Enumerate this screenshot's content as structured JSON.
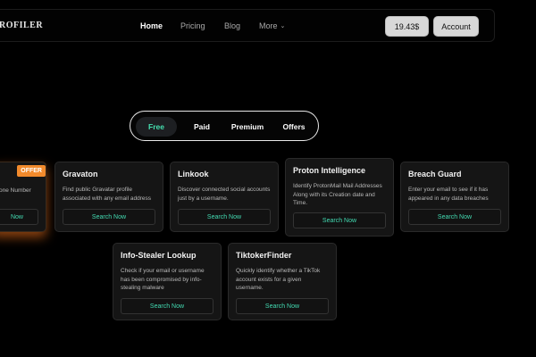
{
  "navbar": {
    "brand": "ROFILER",
    "links": [
      {
        "label": "Home",
        "active": true
      },
      {
        "label": "Pricing",
        "active": false
      },
      {
        "label": "Blog",
        "active": false
      },
      {
        "label": "More",
        "active": false
      }
    ],
    "balance": "19.43$",
    "account": "Account"
  },
  "tabs": [
    {
      "label": "Free",
      "active": true
    },
    {
      "label": "Paid",
      "active": false
    },
    {
      "label": "Premium",
      "active": false
    },
    {
      "label": "Offers",
      "active": false
    }
  ],
  "cards": {
    "partial": {
      "badge": "OFFER",
      "desc": "one Number",
      "button": "Now"
    },
    "gravaton": {
      "title": "Gravaton",
      "desc": "Find public Gravatar profile associated with any email address",
      "button": "Search Now"
    },
    "linkook": {
      "title": "Linkook",
      "desc": "Discover connected social accounts just by a username.",
      "button": "Search Now"
    },
    "proton": {
      "title": "Proton Intelligence",
      "desc": "Identify ProtonMail Mail Addresses Along with its Creation date and Time.",
      "button": "Search Now"
    },
    "breach": {
      "title": "Breach Guard",
      "desc": "Enter your email to see if it has appeared in any data breaches",
      "button": "Search Now"
    },
    "infostealer": {
      "title": "Info-Stealer Lookup",
      "desc": "Check if your email or username has been compromised by info-stealing malware",
      "button": "Search Now"
    },
    "tiktok": {
      "title": "TiktokerFinder",
      "desc": "Quickly identify whether a TikTok account exists for a given username.",
      "button": "Search Now"
    }
  },
  "colors": {
    "accent": "#43dcb3",
    "offer": "#f28a2c",
    "tab_active": "#45e0b0"
  }
}
